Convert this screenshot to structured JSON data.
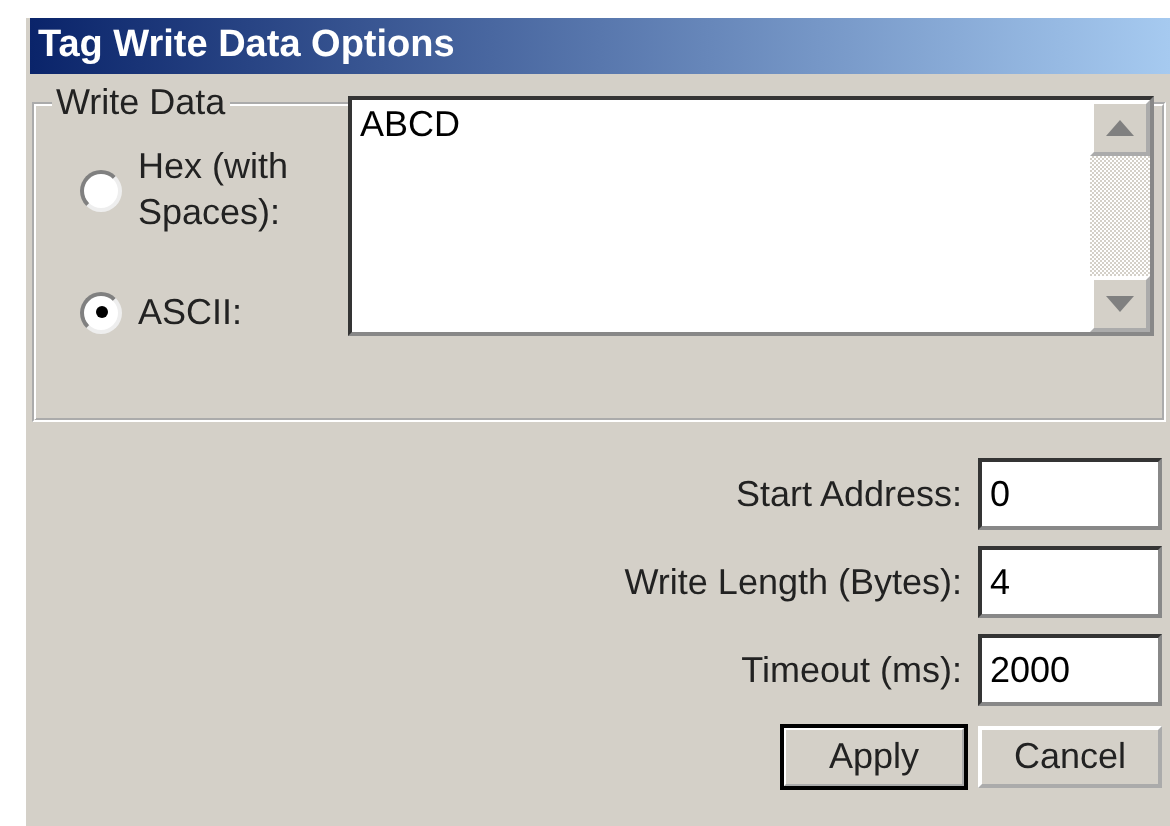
{
  "window": {
    "title": "Tag Write Data Options"
  },
  "write_data": {
    "label": "Write Data",
    "options": [
      {
        "label": "Hex (with Spaces):",
        "selected": false
      },
      {
        "label": "ASCII:",
        "selected": true
      }
    ],
    "value": "ABCD"
  },
  "fields": [
    {
      "label": "Start Address:",
      "value": "0"
    },
    {
      "label": "Write Length (Bytes):",
      "value": "4"
    },
    {
      "label": "Timeout (ms):",
      "value": "2000"
    }
  ],
  "buttons": [
    {
      "label": "Apply",
      "default": true
    },
    {
      "label": "Cancel",
      "default": false
    }
  ]
}
